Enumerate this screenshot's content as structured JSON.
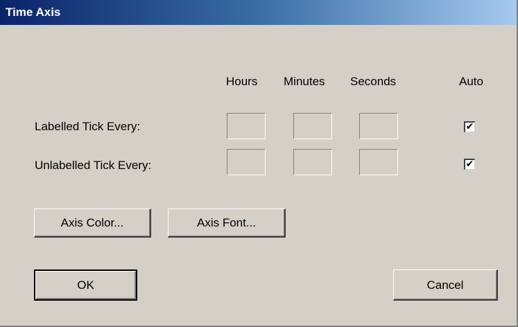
{
  "window": {
    "title": "Time Axis"
  },
  "columns": {
    "hours": "Hours",
    "minutes": "Minutes",
    "seconds": "Seconds",
    "auto": "Auto"
  },
  "rows": [
    {
      "label": "Labelled Tick Every:",
      "hours": "",
      "minutes": "",
      "seconds": "",
      "auto_checked": true
    },
    {
      "label": "Unlabelled Tick Every:",
      "hours": "",
      "minutes": "",
      "seconds": "",
      "auto_checked": true
    }
  ],
  "checkmark": "✔",
  "buttons": {
    "axis_color": "Axis Color...",
    "axis_font": "Axis Font...",
    "ok": "OK",
    "cancel": "Cancel"
  },
  "colors": {
    "titlebar_start": "#0a246a",
    "titlebar_end": "#a6caf0",
    "dialog_face": "#d4d0c8"
  }
}
